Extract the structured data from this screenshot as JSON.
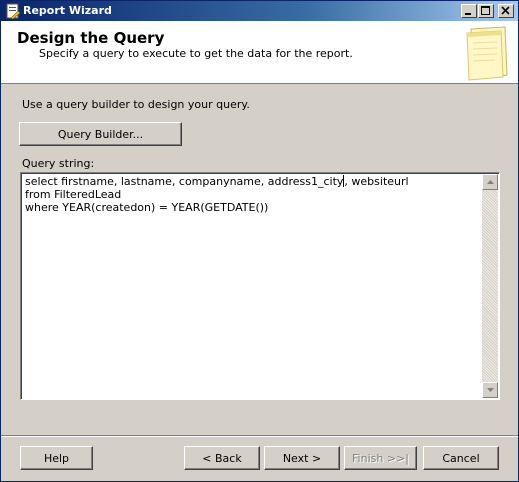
{
  "window": {
    "title": "Report Wizard",
    "icons": {
      "app": "report-wizard-icon",
      "minimize": "minimize-icon",
      "maximize": "maximize-icon",
      "close": "close-icon"
    }
  },
  "header": {
    "title": "Design the Query",
    "subtitle": "Specify a query to execute to get the data for the report.",
    "icon": "notepad-icon"
  },
  "body": {
    "instruction": "Use a query builder to design your query.",
    "query_builder_label": "Query Builder...",
    "query_label": "Query string:",
    "query_lines": [
      "select firstname, lastname, companyname, address1_city",
      ", websiteurl",
      "from FilteredLead",
      "where YEAR(createdon) = YEAR(GETDATE())"
    ]
  },
  "footer": {
    "help_label": "Help",
    "back_label": "< Back",
    "next_label": "Next >",
    "finish_label": "Finish >>|",
    "cancel_label": "Cancel"
  }
}
